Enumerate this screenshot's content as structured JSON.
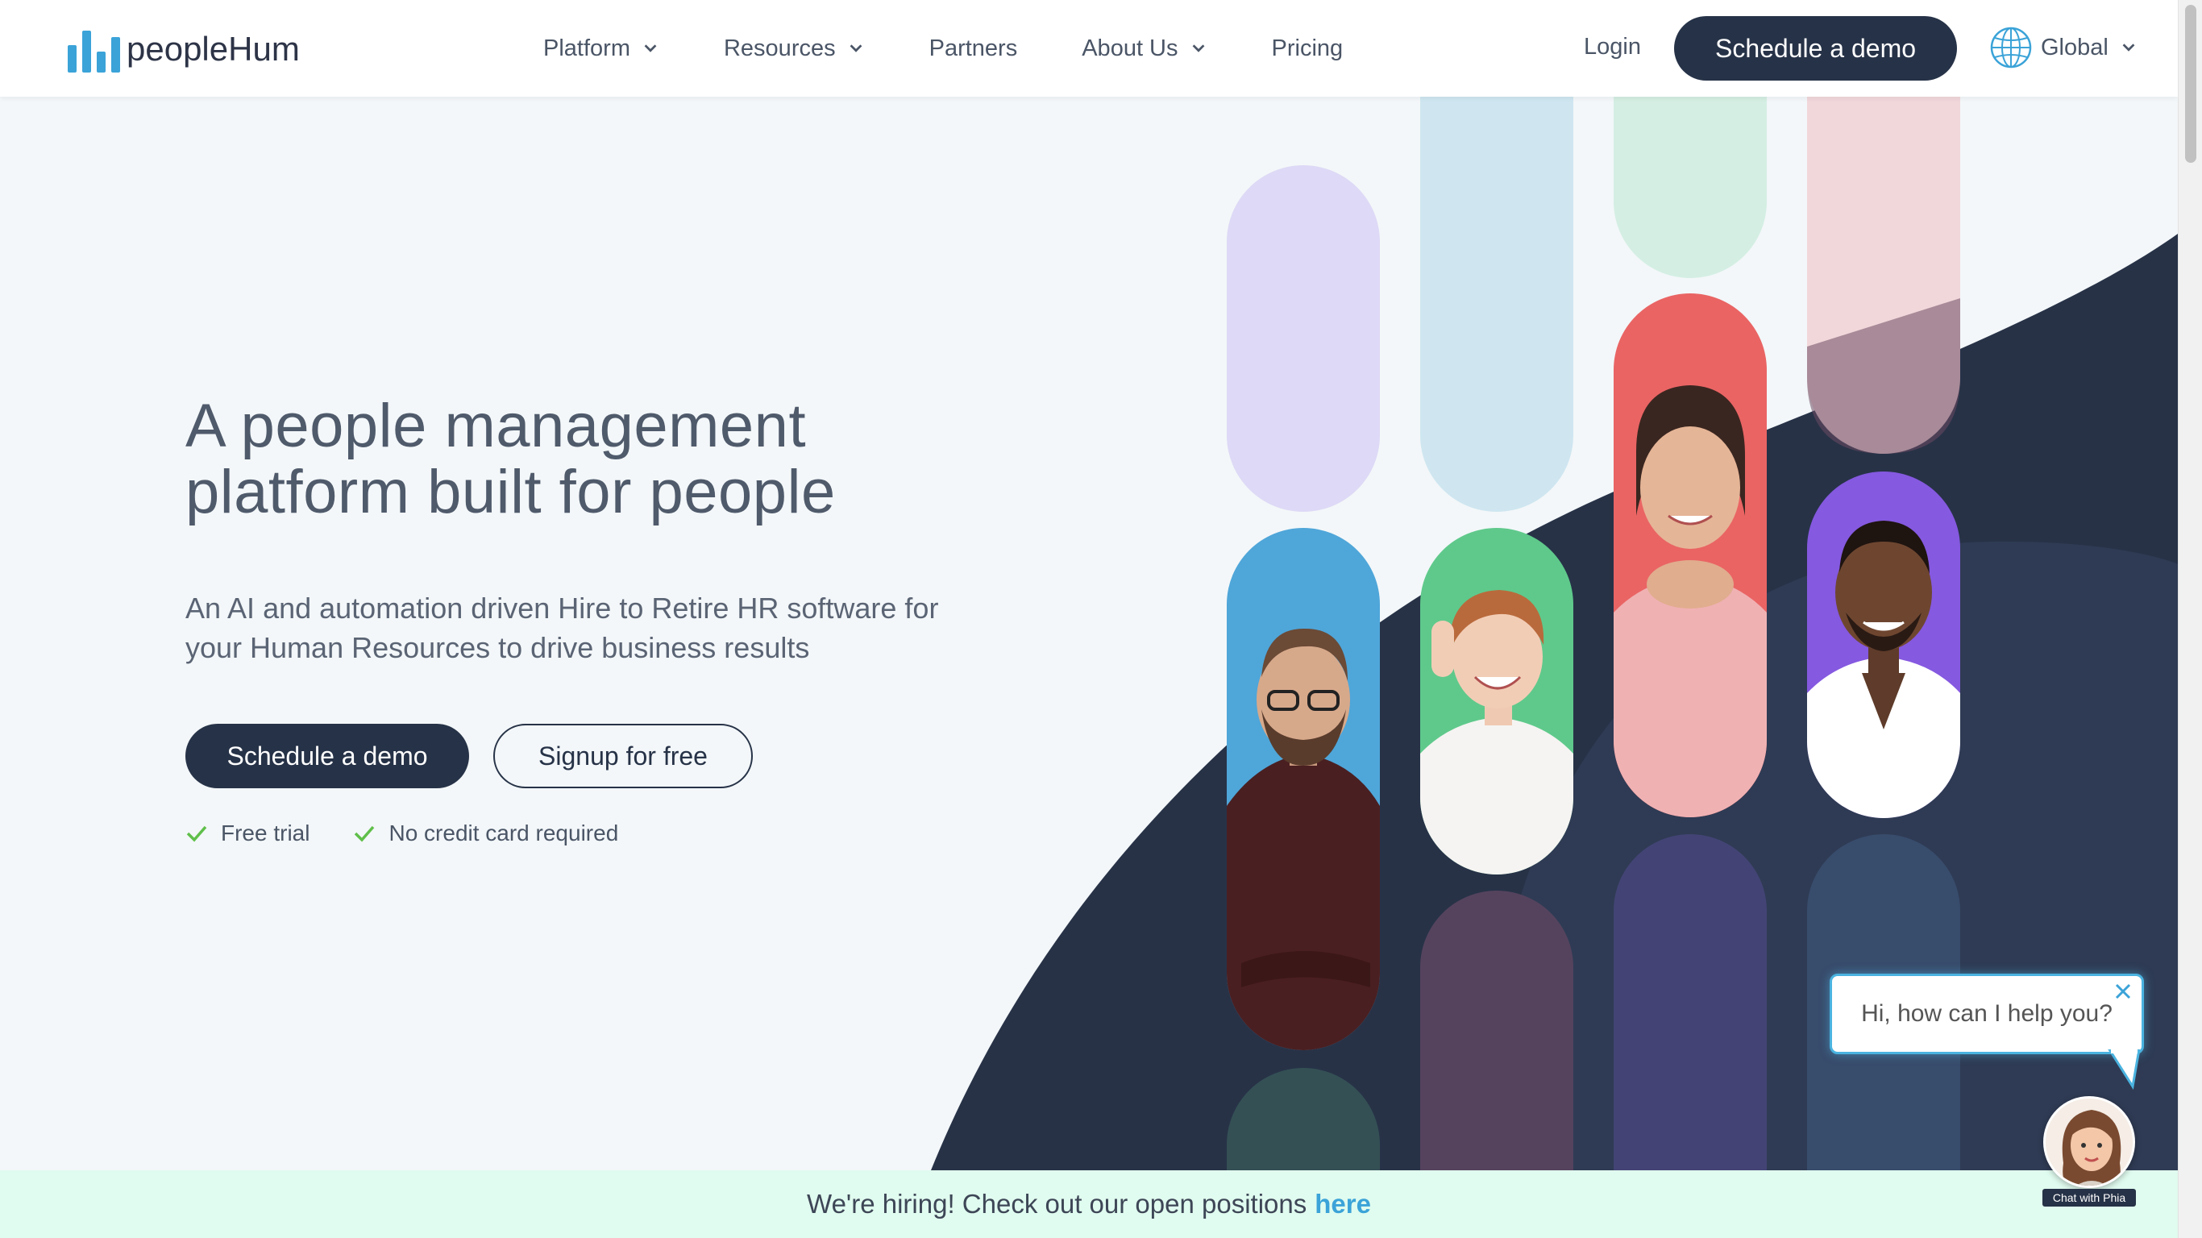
{
  "brand": {
    "name": "peopleHum"
  },
  "nav": {
    "items": [
      {
        "label": "Platform",
        "has_dropdown": true
      },
      {
        "label": "Resources",
        "has_dropdown": true
      },
      {
        "label": "Partners",
        "has_dropdown": false
      },
      {
        "label": "About Us",
        "has_dropdown": true
      },
      {
        "label": "Pricing",
        "has_dropdown": false
      }
    ],
    "login": "Login",
    "demo_button": "Schedule a demo",
    "region": "Global"
  },
  "hero": {
    "title_line1": "A people management",
    "title_line2": "platform built for people",
    "subtitle_line1": "An AI and automation driven Hire to Retire HR software for",
    "subtitle_line2": "your Human Resources to drive business results",
    "primary_button": "Schedule a demo",
    "secondary_button": "Signup for free",
    "perks": [
      "Free trial",
      "No credit card required"
    ]
  },
  "chat": {
    "message": "Hi, how can I help you?",
    "label": "Chat with Phia"
  },
  "hiring_banner": {
    "text": "We're hiring! Check out our open positions",
    "link": "here"
  },
  "colors": {
    "navy": "#263247",
    "accent_blue": "#3ba3d8",
    "check_green": "#5fbf4a",
    "banner_bg": "#e0fbef",
    "page_bg": "#f3f7f9"
  }
}
